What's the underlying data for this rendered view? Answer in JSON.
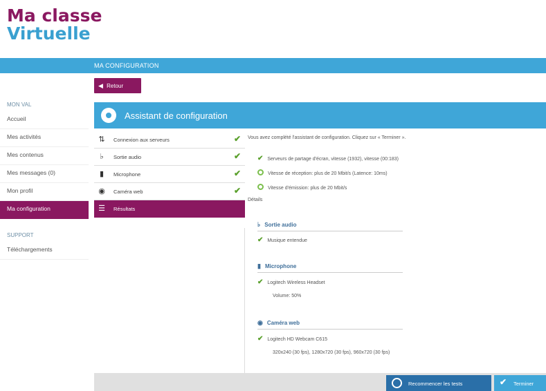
{
  "logo": {
    "line1": "Ma classe",
    "line2": "Virtuelle"
  },
  "topbar": {
    "title": "MA CONFIGURATION"
  },
  "sidebar": {
    "section_title": "MON VAL",
    "items": [
      {
        "label": "Accueil"
      },
      {
        "label": "Mes activités"
      },
      {
        "label": "Mes contenus"
      },
      {
        "label": "Mes messages (0)"
      },
      {
        "label": "Mon profil"
      },
      {
        "label": "Ma configuration"
      }
    ],
    "support_title": "SUPPORT",
    "support_items": [
      {
        "label": "Téléchargements"
      }
    ]
  },
  "back_button": {
    "label": "Retour"
  },
  "panel": {
    "title": "Assistant de configuration"
  },
  "steps": [
    {
      "icon": "network-icon",
      "label": "Connexion aux serveurs",
      "done": true
    },
    {
      "icon": "speaker-icon",
      "label": "Sortie audio",
      "done": true
    },
    {
      "icon": "microphone-icon",
      "label": "Microphone",
      "done": true
    },
    {
      "icon": "webcam-icon",
      "label": "Caméra web",
      "done": true
    },
    {
      "icon": "results-icon",
      "label": "Résultats",
      "done": false
    }
  ],
  "content": {
    "intro": "Vous avez complété l'assistant de configuration. Cliquez sur « Terminer ».",
    "checks": [
      "Serveurs de partage d'écran, vitesse (1932), vitesse (00:183)",
      "Vitesse de réception: plus de 20 Mbit/s (Latence: 10ms)",
      "Vitesse d'émission: plus de 20 Mbit/s"
    ],
    "details_label": "Détails",
    "sections": [
      {
        "title": "Sortie audio",
        "icon": "speaker-icon",
        "lines": [
          "Musique entendue"
        ]
      },
      {
        "title": "Microphone",
        "icon": "microphone-icon",
        "lines": [
          "Logitech Wireless Headset"
        ],
        "extra": "Volume: 50%"
      },
      {
        "title": "Caméra web",
        "icon": "webcam-icon",
        "lines": [
          "Logitech HD Webcam C615"
        ],
        "extra": "320x240 (30 fps), 1280x720 (30 fps), 960x720 (30 fps)"
      }
    ]
  },
  "footer": {
    "restart_label": "Recommencer les tests",
    "finish_label": "Terminer"
  },
  "colors": {
    "brand": "#8a1860",
    "accent": "#3fa6d8",
    "ok": "#5aa02c"
  }
}
